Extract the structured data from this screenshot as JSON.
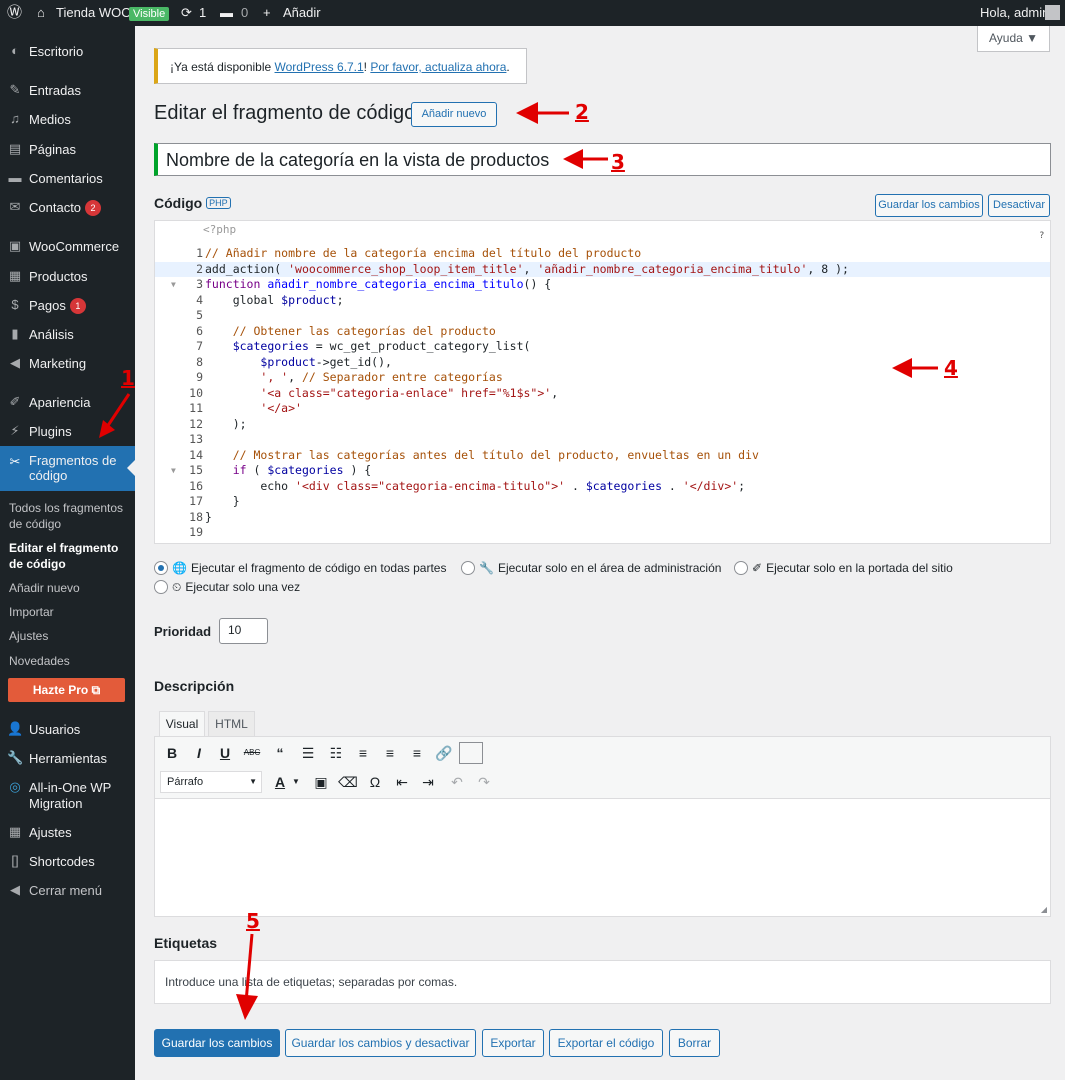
{
  "admin_bar": {
    "site_name": "Tienda WOO",
    "visible_badge": "Visible",
    "updates_count": "1",
    "comments_count": "0",
    "new_label": "Añadir",
    "greeting": "Hola, admin"
  },
  "sidebar": {
    "items": [
      {
        "label": "Escritorio",
        "icon": "dashboard-icon"
      },
      {
        "label": "Entradas",
        "icon": "pin-icon"
      },
      {
        "label": "Medios",
        "icon": "media-icon"
      },
      {
        "label": "Páginas",
        "icon": "pages-icon"
      },
      {
        "label": "Comentarios",
        "icon": "comments-icon"
      },
      {
        "label": "Contacto",
        "icon": "mail-icon",
        "badge": "2"
      },
      {
        "label": "WooCommerce",
        "icon": "woo-icon"
      },
      {
        "label": "Productos",
        "icon": "archive-icon"
      },
      {
        "label": "Pagos",
        "icon": "payments-icon",
        "badge": "1"
      },
      {
        "label": "Análisis",
        "icon": "chart-icon"
      },
      {
        "label": "Marketing",
        "icon": "megaphone-icon"
      },
      {
        "label": "Apariencia",
        "icon": "brush-icon"
      },
      {
        "label": "Plugins",
        "icon": "plug-icon"
      },
      {
        "label": "Fragmentos de código",
        "icon": "scissors-icon"
      },
      {
        "label": "Usuarios",
        "icon": "users-icon"
      },
      {
        "label": "Herramientas",
        "icon": "wrench-icon"
      },
      {
        "label": "All-in-One WP Migration",
        "icon": "migration-icon"
      },
      {
        "label": "Ajustes",
        "icon": "settings-icon"
      },
      {
        "label": "Shortcodes",
        "icon": "brackets-icon"
      },
      {
        "label": "Cerrar menú",
        "icon": "collapse-icon"
      }
    ],
    "submenu": [
      "Todos los fragmentos de código",
      "Editar el fragmento de código",
      "Añadir nuevo",
      "Importar",
      "Ajustes",
      "Novedades"
    ],
    "pro_button": "Hazte Pro"
  },
  "notice": {
    "prefix": "¡Ya está disponible ",
    "link1": "WordPress 6.7.1",
    "middle": "! ",
    "link2": "Por favor, actualiza ahora",
    "suffix": "."
  },
  "help_tab": "Ayuda ▼",
  "page": {
    "title": "Editar el fragmento de código",
    "add_new_button": "Añadir nuevo",
    "snippet_title": "Nombre de la categoría en la vista de productos"
  },
  "code": {
    "label": "Código",
    "lang_badge": "PHP",
    "save_button": "Guardar los cambios",
    "deactivate_button": "Desactivar",
    "open_tag": "<?php",
    "help_mark": "?",
    "line_numbers": [
      "1",
      "2",
      "3",
      "4",
      "5",
      "6",
      "7",
      "8",
      "9",
      "10",
      "11",
      "12",
      "13",
      "14",
      "15",
      "16",
      "17",
      "18",
      "19"
    ]
  },
  "scope": {
    "options": [
      "Ejecutar el fragmento de código en todas partes",
      "Ejecutar solo en el área de administración",
      "Ejecutar solo en la portada del sitio",
      "Ejecutar solo una vez"
    ]
  },
  "priority": {
    "label": "Prioridad",
    "value": "10"
  },
  "description": {
    "label": "Descripción",
    "tab_visual": "Visual",
    "tab_html": "HTML",
    "format_select": "Párrafo"
  },
  "tags": {
    "label": "Etiquetas",
    "placeholder": "Introduce una lista de etiquetas; separadas por comas."
  },
  "actions": {
    "save": "Guardar los cambios",
    "save_deactivate": "Guardar los cambios y desactivar",
    "export": "Exportar",
    "export_code": "Exportar el código",
    "delete": "Borrar"
  },
  "annotations": [
    "1",
    "2",
    "3",
    "4",
    "5"
  ],
  "colors": {
    "accent": "#2271b1",
    "annotation_red": "#e00000",
    "active_green": "#00a32a",
    "notice_yellow": "#dba617"
  }
}
